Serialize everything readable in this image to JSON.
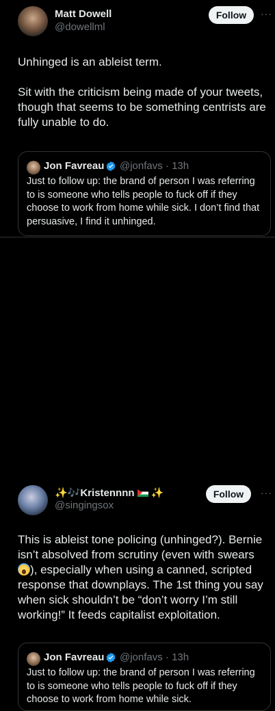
{
  "posts": [
    {
      "author": {
        "name": "Matt Dowell",
        "handle": "@dowellml"
      },
      "follow_label": "Follow",
      "more_label": "···",
      "body": [
        "Unhinged is an ableist term.",
        "Sit with the criticism being made of your tweets, though that seems to be something centrists are fully unable to do."
      ],
      "quote": {
        "name": "Jon Favreau",
        "handle": "@jonfavs · 13h",
        "text": "Just to follow up: the brand of person I was referring to is someone who tells people to fuck off if they choose to work from home while sick. I don’t find that persuasive, I find it unhinged."
      }
    },
    {
      "author": {
        "name_prefix": "✨🎶Kristennnn",
        "name_suffix": "✨",
        "handle": "@singingsox"
      },
      "follow_label": "Follow",
      "more_label": "···",
      "body_part1": "This is ableist tone policing (unhinged?). Bernie isn’t absolved from scrutiny (even with swears ",
      "body_part2": "), especially when using a canned, scripted response that downplays. The 1st thing you say when sick shouldn’t be “don’t worry I’m still working!” It feeds capitalist exploitation.",
      "quote": {
        "name": "Jon Favreau",
        "handle": "@jonfavs · 13h",
        "text": "Just to follow up: the brand of person I was referring to is someone who tells people to fuck off if they choose to work from home while sick."
      }
    }
  ],
  "colors": {
    "background": "#000000",
    "text": "#e7e9ea",
    "secondary": "#71767b",
    "border": "#2f3336",
    "verified": "#1d9bf0",
    "follow_bg": "#eff3f4"
  }
}
